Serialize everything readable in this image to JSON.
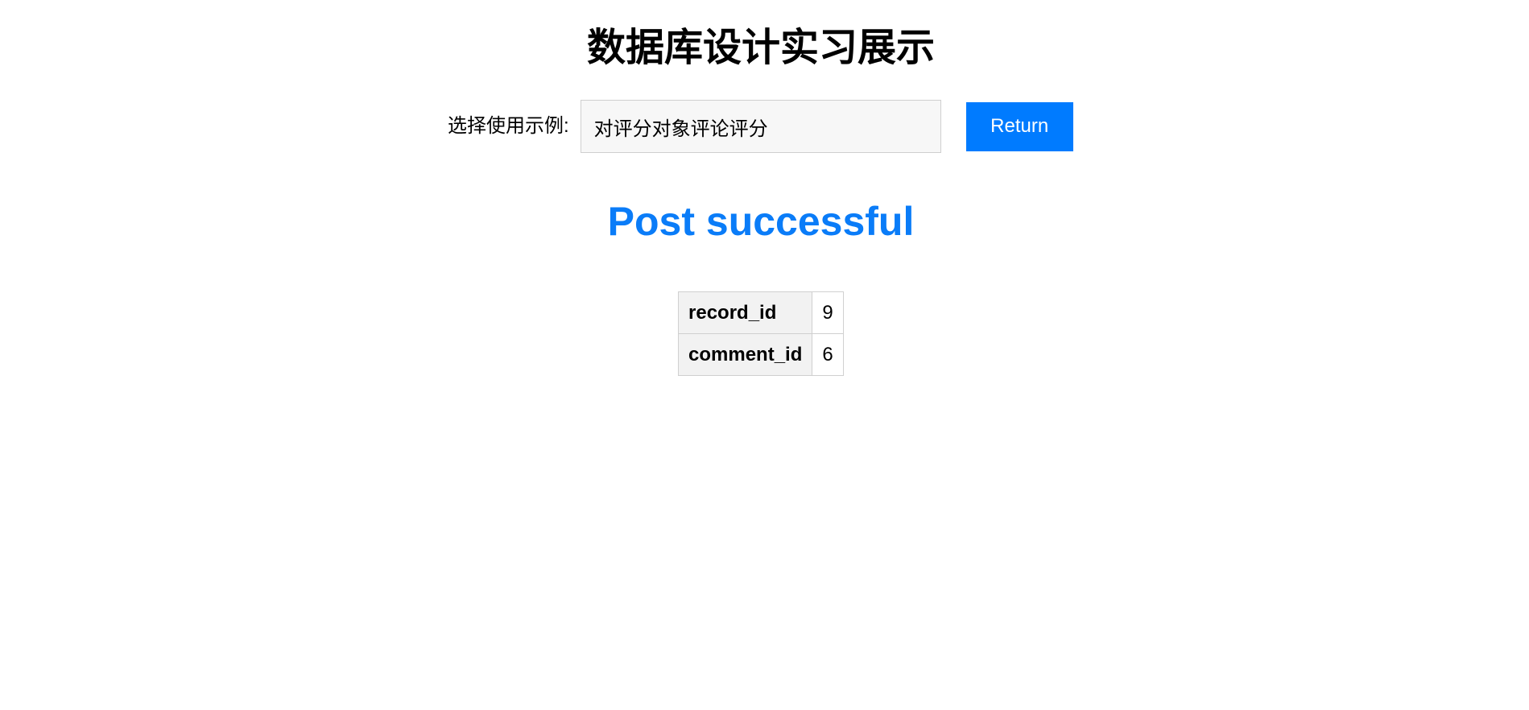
{
  "page": {
    "title": "数据库设计实习展示"
  },
  "selector": {
    "label": "选择使用示例:",
    "selected_value": "对评分对象评论评分"
  },
  "toolbar": {
    "return_label": "Return"
  },
  "status": {
    "message": "Post successful",
    "color": "#0a7cf8"
  },
  "result": {
    "rows": [
      {
        "key": "record_id",
        "value": "9"
      },
      {
        "key": "comment_id",
        "value": "6"
      }
    ]
  },
  "colors": {
    "accent": "#007bff",
    "table_header_bg": "#f2f2f2",
    "select_bg": "#f7f7f7"
  }
}
